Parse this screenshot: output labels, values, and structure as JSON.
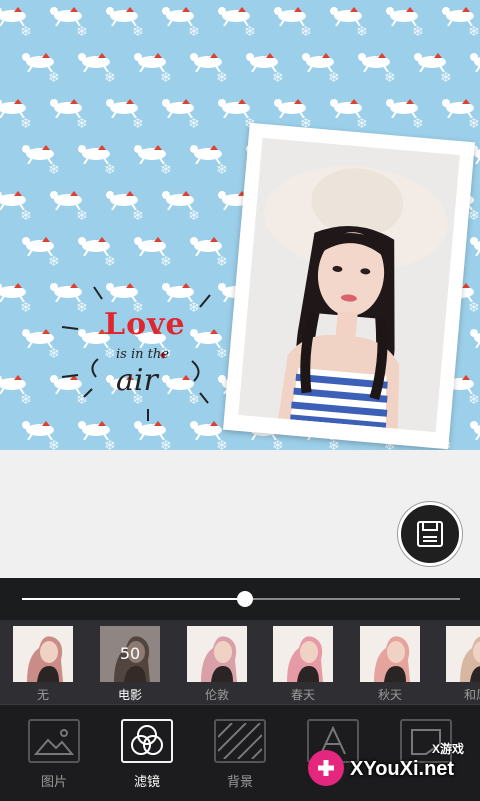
{
  "editor": {
    "sticker": {
      "line1": "Love",
      "line2": "is in the",
      "line3": "air"
    }
  },
  "save": {
    "icon": "floppy-disk-icon"
  },
  "slider": {
    "value": 0.51
  },
  "filters": {
    "selected_value": "50",
    "items": [
      {
        "label": "无",
        "tint": "#c98c86"
      },
      {
        "label": "电影",
        "tint": "#6e5d56"
      },
      {
        "label": "伦敦",
        "tint": "#d9a0a8"
      },
      {
        "label": "春天",
        "tint": "#e59aa6"
      },
      {
        "label": "秋天",
        "tint": "#e4a39c"
      },
      {
        "label": "和风",
        "tint": "#d7b7a2"
      }
    ]
  },
  "toolbar": {
    "items": [
      {
        "label": "图片",
        "icon": "image-icon"
      },
      {
        "label": "滤镜",
        "icon": "filter-circles-icon"
      },
      {
        "label": "背景",
        "icon": "background-pattern-icon"
      },
      {
        "label": "",
        "icon": "text-icon"
      },
      {
        "label": "",
        "icon": "sticker-icon"
      }
    ]
  },
  "watermark": {
    "text": "XYouXi.net",
    "sub": "X游戏"
  },
  "colors": {
    "background_pattern": "#9ccfe9",
    "accent": "#ffffff",
    "sticker_red": "#e0262e",
    "watermark_pink": "#e5267e"
  }
}
